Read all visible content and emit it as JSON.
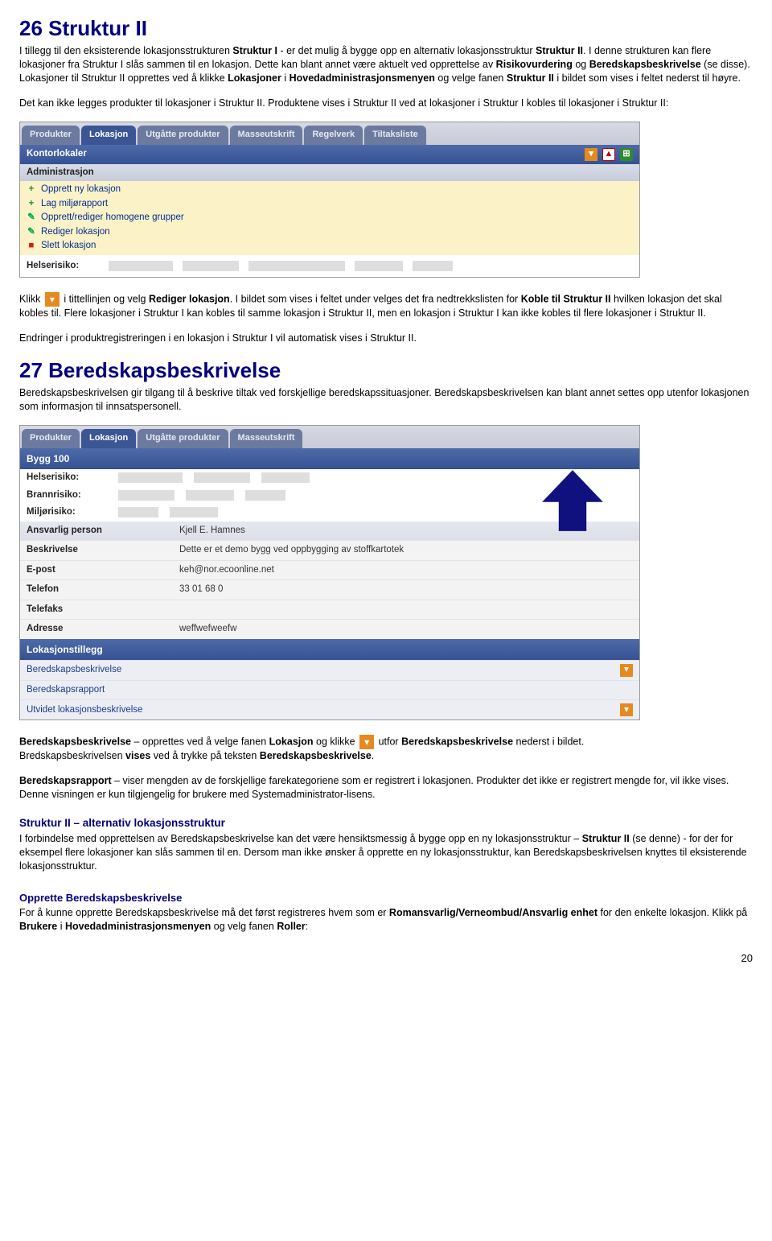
{
  "h26": "26 Struktur II",
  "p26a_1": "I tillegg til den eksisterende lokasjonsstrukturen ",
  "p26a_b1": "Struktur I",
  "p26a_2": " - er det mulig å bygge opp en alternativ lokasjonsstruktur ",
  "p26a_b2": "Struktur II",
  "p26a_3": ". I denne strukturen kan flere lokasjoner fra Struktur I slås sammen til en lokasjon. Dette kan blant annet være aktuelt ved opprettelse av ",
  "p26a_b3": "Risikovurdering",
  "p26a_4": " og ",
  "p26a_b4": "Beredskapsbeskrivelse",
  "p26a_5": " (se disse). Lokasjoner til Struktur II opprettes ved å klikke ",
  "p26a_b5": "Lokasjoner",
  "p26a_6": " i ",
  "p26a_b6": "Hovedadministrasjonsmenyen",
  "p26a_7": " og velge fanen ",
  "p26a_b7": "Struktur II",
  "p26a_8": " i bildet som vises i feltet nederst til høyre.",
  "p26b": "Det kan ikke legges produkter til lokasjoner i Struktur II. Produktene vises i Struktur II ved at lokasjoner i Struktur I kobles til lokasjoner i Struktur II:",
  "panel1": {
    "tabs": [
      "Produkter",
      "Lokasjon",
      "Utgåtte produkter",
      "Masseutskrift",
      "Regelverk",
      "Tiltaksliste"
    ],
    "activeTab": 1,
    "bar": "Kontorlokaler",
    "adminhdr": "Administrasjon",
    "items": [
      "Opprett ny lokasjon",
      "Lag miljørapport",
      "Opprett/rediger homogene grupper",
      "Rediger lokasjon",
      "Slett lokasjon"
    ],
    "risklabel": "Helserisiko:"
  },
  "p26c_1": "Klikk ",
  "p26c_2": " i tittellinjen og velg ",
  "p26c_b1": "Rediger lokasjon",
  "p26c_3": ". I bildet som vises i feltet under velges det fra nedtrekkslisten for ",
  "p26c_b2": "Koble til Struktur II",
  "p26c_4": " hvilken lokasjon det skal kobles til. Flere lokasjoner i Struktur I kan kobles til samme lokasjon i Struktur II, men en lokasjon i Struktur I kan ikke kobles til flere lokasjoner i Struktur II.",
  "p26d": "Endringer i produktregistreringen i en lokasjon i Struktur I vil automatisk vises i Struktur II.",
  "h27": "27 Beredskapsbeskrivelse",
  "p27a": "Beredskapsbeskrivelsen gir tilgang til å beskrive tiltak ved forskjellige beredskapssituasjoner. Beredskapsbeskrivelsen kan blant annet settes opp utenfor lokasjonen som informasjon til innsatspersonell.",
  "panel2": {
    "tabs": [
      "Produkter",
      "Lokasjon",
      "Utgåtte produkter",
      "Masseutskrift"
    ],
    "activeTab": 1,
    "bar": "Bygg 100",
    "riskrows": [
      "Helserisiko:",
      "Brannrisiko:",
      "Miljørisiko:"
    ],
    "info": {
      "Ansvarlig person": "Kjell E. Hamnes",
      "Beskrivelse": "Dette er et demo bygg ved oppbygging av stoffkartotek",
      "E-post": "keh@nor.ecoonline.net",
      "Telefon": "33 01 68 0",
      "Telefaks": "",
      "Adresse": "weffwefweefw"
    },
    "sect": "Lokasjonstillegg",
    "links": [
      "Beredskapsbeskrivelse",
      "Beredskapsrapport",
      "Utvidet lokasjonsbeskrivelse"
    ]
  },
  "p27b_b1": "Beredskapsbeskrivelse",
  "p27b_1": " – opprettes ved å velge fanen ",
  "p27b_b2": "Lokasjon",
  "p27b_2": " og klikke ",
  "p27b_3": " utfor ",
  "p27b_b3": "Beredskapsbeskrivelse",
  "p27b_4": " nederst i bildet.",
  "p27c_1": "Bredskapsbeskrivelsen ",
  "p27c_b1": "vises",
  "p27c_2": " ved å trykke på teksten ",
  "p27c_b2": "Beredskapsbeskrivelse",
  "p27c_3": ".",
  "p27d_b1": "Beredskapsrapport",
  "p27d_1": " – viser mengden av de forskjellige farekategoriene som er registrert i lokasjonen. Produkter det ikke er registrert mengde for, vil ikke vises. Denne visningen er kun tilgjengelig for brukere med Systemadministrator-lisens.",
  "sub1": "Struktur II – alternativ lokasjonsstruktur",
  "p27e_1": "I forbindelse med opprettelsen av Beredskapsbeskrivelse kan det være hensiktsmessig å bygge opp en ny lokasjonsstruktur – ",
  "p27e_b1": "Struktur II",
  "p27e_2": " (se denne) - for der for eksempel flere lokasjoner kan slås sammen til en. Dersom man ikke ønsker å opprette en ny lokasjonsstruktur, kan Beredskapsbeskrivelsen knyttes til eksisterende lokasjonsstruktur.",
  "sub2": "Opprette Beredskapsbeskrivelse",
  "p27f_1": "For å kunne opprette Beredskapsbeskrivelse må det først registreres hvem som er ",
  "p27f_b1": "Romansvarlig/Verneombud/Ansvarlig enhet",
  "p27f_2": " for den enkelte lokasjon. Klikk på ",
  "p27f_b2": "Brukere",
  "p27f_3": " i ",
  "p27f_b3": "Hovedadministrasjonsmenyen",
  "p27f_4": " og velg fanen ",
  "p27f_b4": "Roller",
  "p27f_5": ":",
  "pagenum": "20"
}
